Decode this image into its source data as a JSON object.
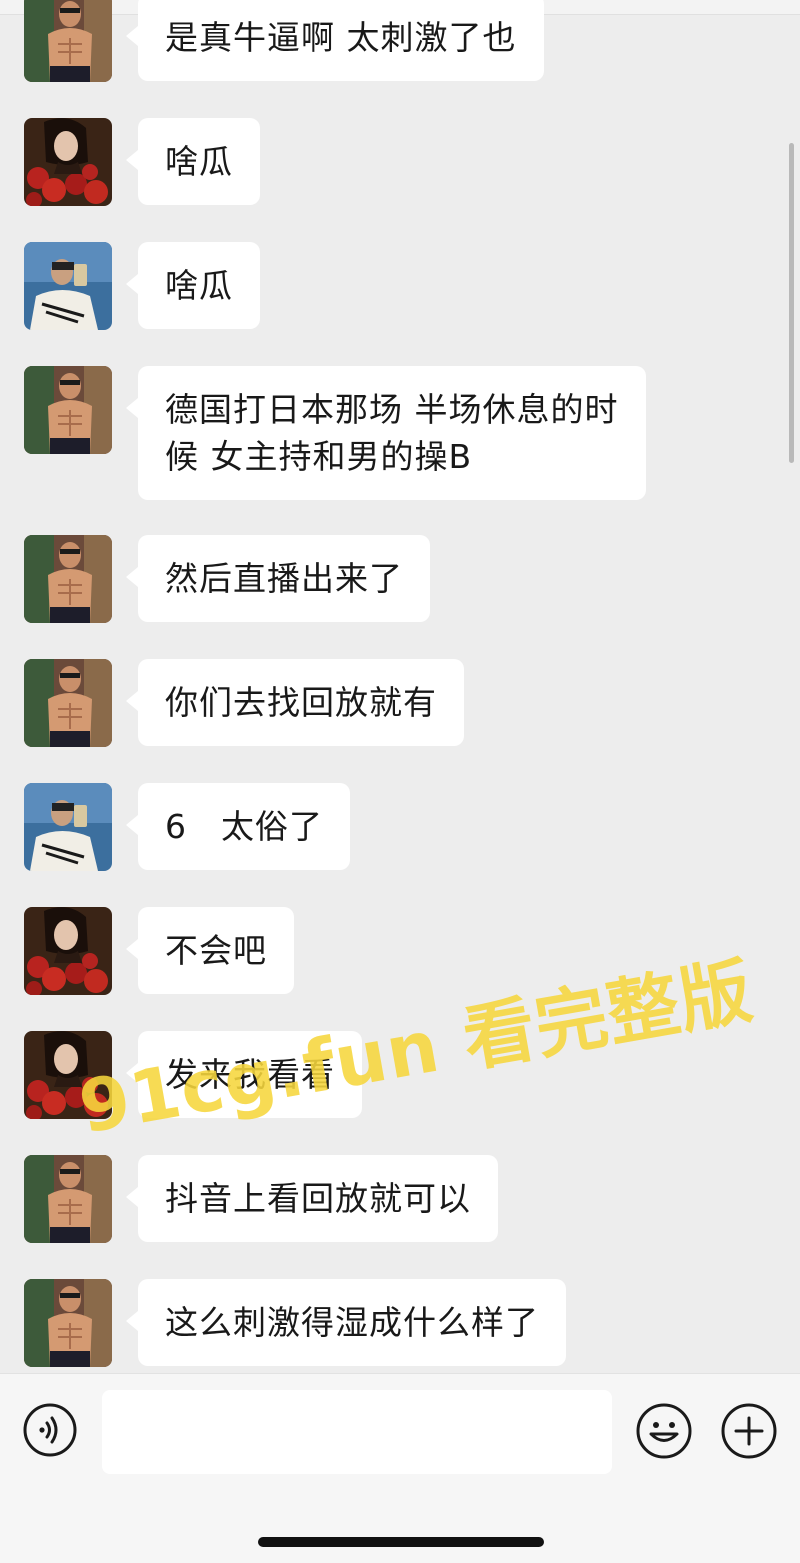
{
  "chat": {
    "messages": [
      {
        "avatar": "avatar-shirtless-man",
        "text": "是真牛逼啊 太刺激了也"
      },
      {
        "avatar": "avatar-woman-roses",
        "text": "啥瓜"
      },
      {
        "avatar": "avatar-mirror-selfie",
        "text": "啥瓜"
      },
      {
        "avatar": "avatar-shirtless-man",
        "text": "德国打日本那场 半场休息的时\n候 女主持和男的操B"
      },
      {
        "avatar": "avatar-shirtless-man",
        "text": "然后直播出来了"
      },
      {
        "avatar": "avatar-shirtless-man",
        "text": "你们去找回放就有"
      },
      {
        "avatar": "avatar-mirror-selfie",
        "text": "6　太俗了"
      },
      {
        "avatar": "avatar-woman-roses",
        "text": "不会吧"
      },
      {
        "avatar": "avatar-woman-roses",
        "text": "发来我看看"
      },
      {
        "avatar": "avatar-shirtless-man",
        "text": "抖音上看回放就可以"
      },
      {
        "avatar": "avatar-shirtless-man",
        "text": "这么刺激得湿成什么样了"
      }
    ]
  },
  "watermark": {
    "text": "91cg.fun 看完整版",
    "color": "#f6d63c"
  },
  "input_bar": {
    "voice_icon": "voice-icon",
    "input_value": "",
    "emoji_icon": "emoji-icon",
    "plus_icon": "plus-icon"
  }
}
